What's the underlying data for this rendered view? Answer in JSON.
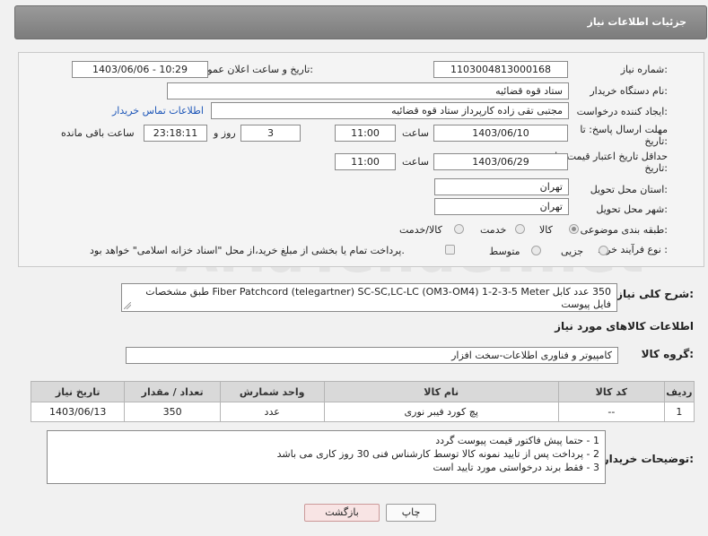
{
  "header": {
    "title": "جزئیات اطلاعات نیاز"
  },
  "form": {
    "need_number": {
      "label": "شماره نیاز:",
      "value": "1103004813000168"
    },
    "announce_datetime": {
      "label": "تاریخ و ساعت اعلان عمومی:",
      "value": "1403/06/06 - 10:29"
    },
    "buyer_org": {
      "label": "نام دستگاه خریدار:",
      "value": "ستاد قوه قضائیه"
    },
    "requester": {
      "label": "ایجاد کننده درخواست:",
      "value": "مجتبی تقی زاده کارپرداز ستاد قوه قضائیه",
      "contact_link": "اطلاعات تماس خریدار"
    },
    "reply_deadline": {
      "label_line1": "مهلت ارسال پاسخ: تا",
      "label_line2": "تاریخ:",
      "date": "1403/06/10",
      "time_label": "ساعت",
      "time": "11:00",
      "days": "3",
      "days_label": "روز و",
      "remaining": "23:18:11",
      "remaining_label": "ساعت باقی مانده"
    },
    "price_validity": {
      "label_line1": "حداقل تاریخ اعتبار قیمت: تا",
      "label_line2": "تاریخ:",
      "date": "1403/06/29",
      "time_label": "ساعت",
      "time": "11:00"
    },
    "province": {
      "label": "استان محل تحویل:",
      "value": "تهران"
    },
    "city": {
      "label": "شهر محل تحویل:",
      "value": "تهران"
    },
    "category": {
      "label": "طبقه بندی موضوعی:",
      "options": [
        "کالا",
        "خدمت",
        "کالا/خدمت"
      ],
      "selected": "کالا"
    },
    "purchase_type": {
      "label": "نوع فرآیند خرید :",
      "options": [
        "جزیی",
        "متوسط"
      ],
      "payment_note": "پرداخت تمام یا بخشی از مبلغ خرید،از محل \"اسناد خزانه اسلامی\" خواهد بود."
    }
  },
  "description": {
    "label": "شرح کلی نیاز:",
    "text": "350 عدد کابل Fiber Patchcord (telegartner) SC-SC,LC-LC (OM3-OM4) 1-2-3-5 Meter طبق مشخصات فایل پیوست"
  },
  "goods_section": {
    "title": "اطلاعات کالاهای مورد نیاز",
    "group_label": "گروه کالا:",
    "group_value": "کامپیوتر و فناوری اطلاعات-سخت افزار"
  },
  "table": {
    "headers": [
      "ردیف",
      "کد کالا",
      "نام کالا",
      "واحد شمارش",
      "تعداد / مقدار",
      "تاریخ نیاز"
    ],
    "rows": [
      [
        "1",
        "--",
        "پچ کورد فیبر نوری",
        "عدد",
        "350",
        "1403/06/13"
      ]
    ]
  },
  "buyer_notes": {
    "label": "توضیحات خریدار:",
    "lines": [
      "1 - حتما پیش فاکتور قیمت پیوست گردد",
      "2 - پرداخت پس از تایید نمونه کالا توسط کارشناس فنی 30 روز کاری می باشد",
      "3 - فقط برند درخواستی مورد تایید است"
    ]
  },
  "buttons": {
    "back": "بازگشت",
    "print": "چاپ"
  },
  "watermark": "AriaTender.net"
}
